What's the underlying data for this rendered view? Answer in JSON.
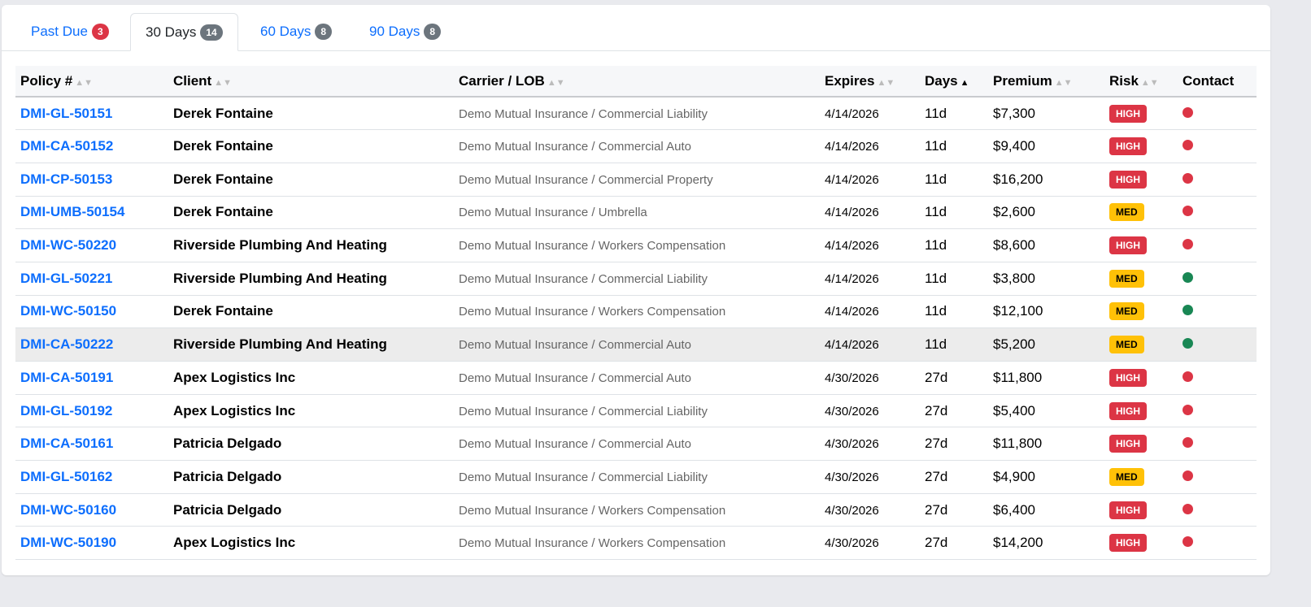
{
  "tabs": [
    {
      "label": "Past Due",
      "count": "3",
      "badge_color": "#dc3545",
      "active": false
    },
    {
      "label": "30 Days",
      "count": "14",
      "badge_color": "#6c757d",
      "active": true
    },
    {
      "label": "60 Days",
      "count": "8",
      "badge_color": "#6c757d",
      "active": false
    },
    {
      "label": "90 Days",
      "count": "8",
      "badge_color": "#6c757d",
      "active": false
    }
  ],
  "columns": [
    {
      "label": "Policy #",
      "sort": "none"
    },
    {
      "label": "Client",
      "sort": "none"
    },
    {
      "label": "Carrier / LOB",
      "sort": "none"
    },
    {
      "label": "Expires",
      "sort": "none"
    },
    {
      "label": "Days",
      "sort": "asc"
    },
    {
      "label": "Premium",
      "sort": "none"
    },
    {
      "label": "Risk",
      "sort": "none"
    },
    {
      "label": "Contact"
    }
  ],
  "colors": {
    "high": "#dc3545",
    "med": "#ffc107",
    "red_dot": "#dc3545",
    "green_dot": "#198754"
  },
  "rows": [
    {
      "policy": "DMI-GL-50151",
      "client": "Derek Fontaine",
      "carrier": "Demo Mutual Insurance / Commercial Liability",
      "expires": "4/14/2026",
      "days": "11d",
      "premium": "$7,300",
      "risk": "HIGH",
      "contact": "red"
    },
    {
      "policy": "DMI-CA-50152",
      "client": "Derek Fontaine",
      "carrier": "Demo Mutual Insurance / Commercial Auto",
      "expires": "4/14/2026",
      "days": "11d",
      "premium": "$9,400",
      "risk": "HIGH",
      "contact": "red"
    },
    {
      "policy": "DMI-CP-50153",
      "client": "Derek Fontaine",
      "carrier": "Demo Mutual Insurance / Commercial Property",
      "expires": "4/14/2026",
      "days": "11d",
      "premium": "$16,200",
      "risk": "HIGH",
      "contact": "red"
    },
    {
      "policy": "DMI-UMB-50154",
      "client": "Derek Fontaine",
      "carrier": "Demo Mutual Insurance / Umbrella",
      "expires": "4/14/2026",
      "days": "11d",
      "premium": "$2,600",
      "risk": "MED",
      "contact": "red"
    },
    {
      "policy": "DMI-WC-50220",
      "client": "Riverside Plumbing And Heating",
      "carrier": "Demo Mutual Insurance / Workers Compensation",
      "expires": "4/14/2026",
      "days": "11d",
      "premium": "$8,600",
      "risk": "HIGH",
      "contact": "red"
    },
    {
      "policy": "DMI-GL-50221",
      "client": "Riverside Plumbing And Heating",
      "carrier": "Demo Mutual Insurance / Commercial Liability",
      "expires": "4/14/2026",
      "days": "11d",
      "premium": "$3,800",
      "risk": "MED",
      "contact": "green"
    },
    {
      "policy": "DMI-WC-50150",
      "client": "Derek Fontaine",
      "carrier": "Demo Mutual Insurance / Workers Compensation",
      "expires": "4/14/2026",
      "days": "11d",
      "premium": "$12,100",
      "risk": "MED",
      "contact": "green"
    },
    {
      "policy": "DMI-CA-50222",
      "client": "Riverside Plumbing And Heating",
      "carrier": "Demo Mutual Insurance / Commercial Auto",
      "expires": "4/14/2026",
      "days": "11d",
      "premium": "$5,200",
      "risk": "MED",
      "contact": "green",
      "highlighted": true
    },
    {
      "policy": "DMI-CA-50191",
      "client": "Apex Logistics Inc",
      "carrier": "Demo Mutual Insurance / Commercial Auto",
      "expires": "4/30/2026",
      "days": "27d",
      "premium": "$11,800",
      "risk": "HIGH",
      "contact": "red"
    },
    {
      "policy": "DMI-GL-50192",
      "client": "Apex Logistics Inc",
      "carrier": "Demo Mutual Insurance / Commercial Liability",
      "expires": "4/30/2026",
      "days": "27d",
      "premium": "$5,400",
      "risk": "HIGH",
      "contact": "red"
    },
    {
      "policy": "DMI-CA-50161",
      "client": "Patricia Delgado",
      "carrier": "Demo Mutual Insurance / Commercial Auto",
      "expires": "4/30/2026",
      "days": "27d",
      "premium": "$11,800",
      "risk": "HIGH",
      "contact": "red"
    },
    {
      "policy": "DMI-GL-50162",
      "client": "Patricia Delgado",
      "carrier": "Demo Mutual Insurance / Commercial Liability",
      "expires": "4/30/2026",
      "days": "27d",
      "premium": "$4,900",
      "risk": "MED",
      "contact": "red"
    },
    {
      "policy": "DMI-WC-50160",
      "client": "Patricia Delgado",
      "carrier": "Demo Mutual Insurance / Workers Compensation",
      "expires": "4/30/2026",
      "days": "27d",
      "premium": "$6,400",
      "risk": "HIGH",
      "contact": "red"
    },
    {
      "policy": "DMI-WC-50190",
      "client": "Apex Logistics Inc",
      "carrier": "Demo Mutual Insurance / Workers Compensation",
      "expires": "4/30/2026",
      "days": "27d",
      "premium": "$14,200",
      "risk": "HIGH",
      "contact": "red"
    }
  ]
}
